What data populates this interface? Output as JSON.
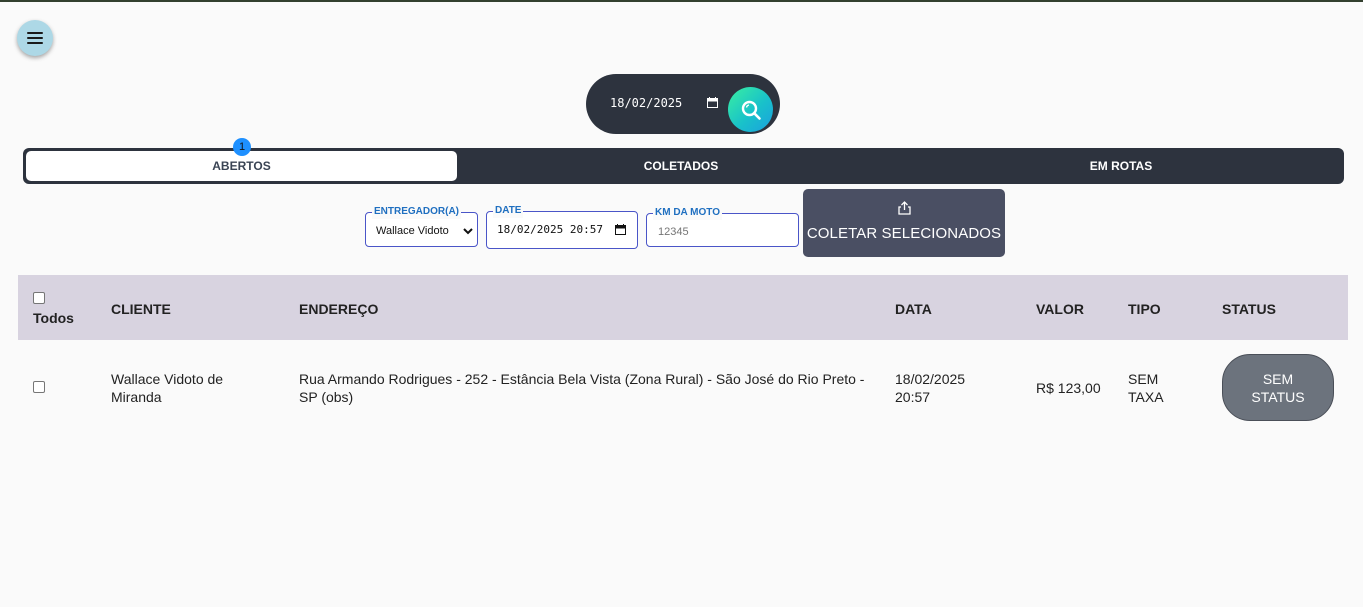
{
  "header": {
    "menu_icon": "hamburger-menu-icon",
    "date_value": "18/02/2025",
    "search_icon": "search-icon",
    "search_gradient": [
      "#3af0a0",
      "#1aa0e0"
    ]
  },
  "tabs": [
    {
      "label": "ABERTOS",
      "active": true,
      "badge": "1"
    },
    {
      "label": "COLETADOS",
      "active": false
    },
    {
      "label": "EM ROTAS",
      "active": false
    }
  ],
  "form": {
    "entregador": {
      "legend": "ENTREGADOR(A)",
      "selected": "Wallace Vidoto"
    },
    "date": {
      "legend": "DATE",
      "value": "18/02/2025 20:57"
    },
    "km": {
      "legend": "KM DA MOTO",
      "placeholder": "12345"
    },
    "collect_button": {
      "label": "COLETAR SELECIONADOS",
      "icon": "share-icon"
    }
  },
  "table": {
    "headers": {
      "select_all": "Todos",
      "cliente": "CLIENTE",
      "endereco": "ENDEREÇO",
      "data": "DATA",
      "valor": "VALOR",
      "tipo": "TIPO",
      "status": "STATUS"
    },
    "rows": [
      {
        "cliente_l1": "Wallace Vidoto de",
        "cliente_l2": "Miranda",
        "endereco_l1": "Rua Armando Rodrigues - 252 - Estância Bela Vista (Zona Rural) - São José do Rio Preto -",
        "endereco_l2": "SP (obs)",
        "data_l1": "18/02/2025",
        "data_l2": "20:57",
        "valor": "R$ 123,00",
        "tipo_l1": "SEM",
        "tipo_l2": "TAXA",
        "status_l1": "SEM",
        "status_l2": "STATUS"
      }
    ]
  },
  "colors": {
    "dark": "#2d333e",
    "header_row": "#d8d3e0",
    "accent_blue": "#1f6fc0",
    "badge": "#1e90ff",
    "status_button": "#6c737d",
    "collect_button": "#4a4f63"
  }
}
